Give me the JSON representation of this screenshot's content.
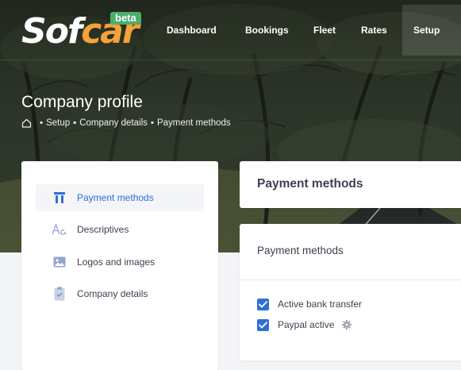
{
  "brand": {
    "name_part1": "Sof",
    "name_part2": "car",
    "badge": "beta"
  },
  "nav": [
    {
      "label": "Dashboard"
    },
    {
      "label": "Bookings"
    },
    {
      "label": "Fleet"
    },
    {
      "label": "Rates"
    },
    {
      "label": "Setup"
    }
  ],
  "page": {
    "title": "Company profile",
    "breadcrumb": [
      "Setup",
      "Company details",
      "Payment methods"
    ]
  },
  "sidebar": {
    "items": [
      {
        "label": "Payment methods",
        "icon": "payment-icon",
        "active": true
      },
      {
        "label": "Descriptives",
        "icon": "font-icon",
        "active": false
      },
      {
        "label": "Logos and images",
        "icon": "image-icon",
        "active": false
      },
      {
        "label": "Company details",
        "icon": "clipboard-icon",
        "active": false
      }
    ]
  },
  "main": {
    "header_title": "Payment methods",
    "section_title": "Payment methods",
    "options": [
      {
        "label": "Active bank transfer",
        "checked": true
      },
      {
        "label": "Paypal active",
        "checked": true
      }
    ]
  },
  "colors": {
    "accent": "#2f6fd8",
    "brand_orange": "#f6a13a",
    "badge_green": "#4cae6a"
  }
}
